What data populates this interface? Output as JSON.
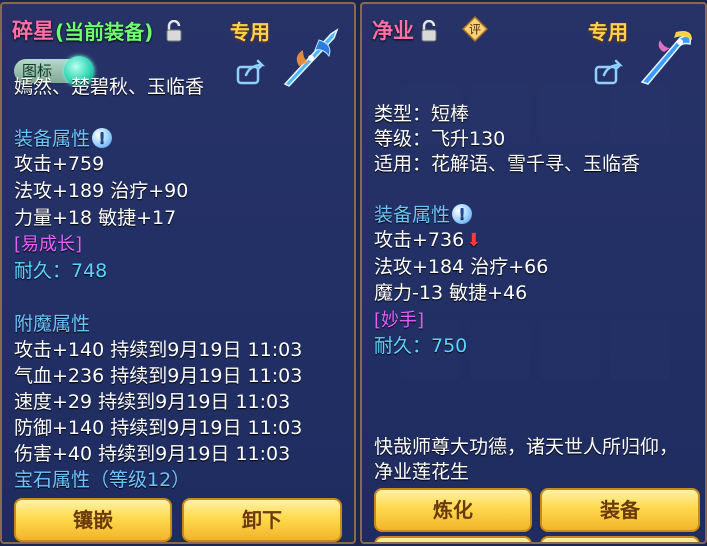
{
  "left": {
    "title": "碎星",
    "equipped_tag": "(当前装备)",
    "special": "专用",
    "toggle_label": "图标",
    "users_line": "嫣然、楚碧秋、玉临香",
    "attr_section": "装备属性",
    "stats": [
      "攻击+759",
      "法攻+189 治疗+90",
      "力量+18 敏捷+17"
    ],
    "effect": "[易成长]",
    "durability": "耐久：748",
    "enchant_section": "附魔属性",
    "enchant": [
      "攻击+140 持续到9月19日 11:03",
      "气血+236 持续到9月19日 11:03",
      "速度+29 持续到9月19日 11:03",
      "防御+140 持续到9月19日 11:03",
      "伤害+40 持续到9月19日 11:03"
    ],
    "gem_section": "宝石属性（等级12）",
    "buttons": {
      "inlay": "镶嵌",
      "unequip": "卸下"
    }
  },
  "right": {
    "title": "净业",
    "appraise_badge": "评",
    "special": "专用",
    "type_line": "类型：短棒",
    "level_line": "等级：飞升130",
    "users_line": "适用：花解语、雪千寻、玉临香",
    "attr_section": "装备属性",
    "stats": [
      "攻击+736",
      "法攻+184 治疗+66",
      "魔力-13 敏捷+46"
    ],
    "effect": "[妙手]",
    "durability": "耐久：750",
    "description": [
      "快哉师尊大功德，诸天世人所归仰，",
      "净业莲花生"
    ],
    "buttons": {
      "refine": "炼化",
      "equip": "装备"
    }
  },
  "colors": {
    "panel_border": "#8a6a4c",
    "special_gold": "#ffd24a",
    "button_gold": "#ffd94e"
  },
  "icons": [
    "lock-icon",
    "share-icon",
    "weapon-icon",
    "info-icon",
    "appraise-badge-icon",
    "down-arrow-icon"
  ]
}
